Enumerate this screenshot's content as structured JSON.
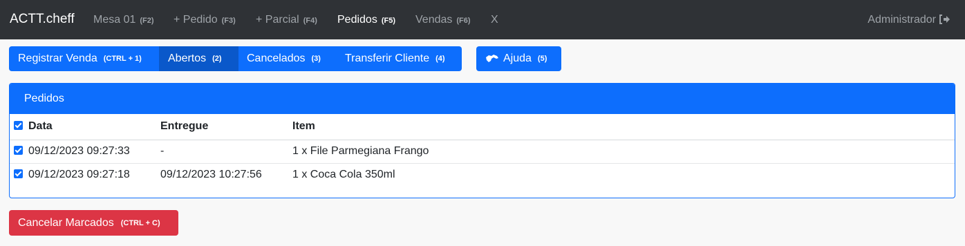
{
  "navbar": {
    "brand": "ACTT.cheff",
    "items": [
      {
        "label": "Mesa 01",
        "kbd": "(F2)"
      },
      {
        "label": "+ Pedido",
        "kbd": "(F3)"
      },
      {
        "label": "+ Parcial",
        "kbd": "(F4)"
      },
      {
        "label": "Pedidos",
        "kbd": "(F5)"
      },
      {
        "label": "Vendas",
        "kbd": "(F6)"
      },
      {
        "label": "X",
        "kbd": ""
      }
    ],
    "user": "Administrador",
    "logout_icon": "sign-out-icon"
  },
  "actions": {
    "registrar": {
      "label": "Registrar Venda",
      "kbd": "(CTRL + 1)"
    },
    "abertos": {
      "label": "Abertos",
      "kbd": "(2)"
    },
    "cancelados": {
      "label": "Cancelados",
      "kbd": "(3)"
    },
    "transferir": {
      "label": "Transferir Cliente",
      "kbd": "(4)"
    },
    "ajuda": {
      "label": "Ajuda",
      "kbd": "(5)",
      "icon": "handshake-icon"
    }
  },
  "card": {
    "title": "Pedidos",
    "columns": [
      "Data",
      "Entregue",
      "Item"
    ],
    "rows": [
      {
        "data": "09/12/2023 09:27:33",
        "entregue": "-",
        "item": "1 x File Parmegiana Frango",
        "checked": true
      },
      {
        "data": "09/12/2023 09:27:18",
        "entregue": "09/12/2023 10:27:56",
        "item": "1 x Coca Cola 350ml",
        "checked": true
      }
    ]
  },
  "cancel_button": {
    "label": "Cancelar Marcados",
    "kbd": "(CTRL + C)"
  },
  "colors": {
    "navbar": "#2f3236",
    "primary": "#0d6efd",
    "primary_active": "#0a58ca",
    "danger": "#dc3545"
  }
}
